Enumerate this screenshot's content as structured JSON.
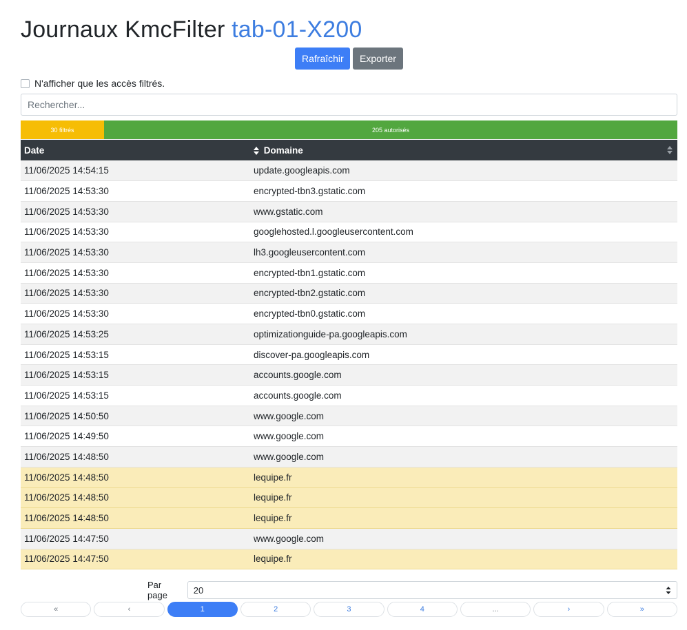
{
  "header": {
    "title": "Journaux KmcFilter",
    "device": "tab-01-X200"
  },
  "toolbar": {
    "refresh_label": "Rafraîchir",
    "export_label": "Exporter"
  },
  "filter": {
    "only_filtered_label": "N'afficher que les accès filtrés.",
    "checked": false
  },
  "search": {
    "placeholder": "Rechercher..."
  },
  "stats": {
    "filtered_label": "30 filtrés",
    "allowed_label": "205 autorisés",
    "filtered_color": "#f6bd05",
    "allowed_color": "#52a73f"
  },
  "table": {
    "headers": [
      "Date",
      "Domaine"
    ],
    "rows": [
      {
        "date": "11/06/2025 14:54:15",
        "domain": "update.googleapis.com",
        "blocked": false
      },
      {
        "date": "11/06/2025 14:53:30",
        "domain": "encrypted-tbn3.gstatic.com",
        "blocked": false
      },
      {
        "date": "11/06/2025 14:53:30",
        "domain": "www.gstatic.com",
        "blocked": false
      },
      {
        "date": "11/06/2025 14:53:30",
        "domain": "googlehosted.l.googleusercontent.com",
        "blocked": false
      },
      {
        "date": "11/06/2025 14:53:30",
        "domain": "lh3.googleusercontent.com",
        "blocked": false
      },
      {
        "date": "11/06/2025 14:53:30",
        "domain": "encrypted-tbn1.gstatic.com",
        "blocked": false
      },
      {
        "date": "11/06/2025 14:53:30",
        "domain": "encrypted-tbn2.gstatic.com",
        "blocked": false
      },
      {
        "date": "11/06/2025 14:53:30",
        "domain": "encrypted-tbn0.gstatic.com",
        "blocked": false
      },
      {
        "date": "11/06/2025 14:53:25",
        "domain": "optimizationguide-pa.googleapis.com",
        "blocked": false
      },
      {
        "date": "11/06/2025 14:53:15",
        "domain": "discover-pa.googleapis.com",
        "blocked": false
      },
      {
        "date": "11/06/2025 14:53:15",
        "domain": "accounts.google.com",
        "blocked": false
      },
      {
        "date": "11/06/2025 14:53:15",
        "domain": "accounts.google.com",
        "blocked": false
      },
      {
        "date": "11/06/2025 14:50:50",
        "domain": "www.google.com",
        "blocked": false
      },
      {
        "date": "11/06/2025 14:49:50",
        "domain": "www.google.com",
        "blocked": false
      },
      {
        "date": "11/06/2025 14:48:50",
        "domain": "www.google.com",
        "blocked": false
      },
      {
        "date": "11/06/2025 14:48:50",
        "domain": "lequipe.fr",
        "blocked": true
      },
      {
        "date": "11/06/2025 14:48:50",
        "domain": "lequipe.fr",
        "blocked": true
      },
      {
        "date": "11/06/2025 14:48:50",
        "domain": "lequipe.fr",
        "blocked": true
      },
      {
        "date": "11/06/2025 14:47:50",
        "domain": "www.google.com",
        "blocked": false
      },
      {
        "date": "11/06/2025 14:47:50",
        "domain": "lequipe.fr",
        "blocked": true
      }
    ]
  },
  "pagination": {
    "per_page_label": "Par page",
    "per_page_value": "20",
    "pages": [
      {
        "label": "«",
        "kind": "muted"
      },
      {
        "label": "‹",
        "kind": "muted"
      },
      {
        "label": "1",
        "kind": "active"
      },
      {
        "label": "2",
        "kind": "link"
      },
      {
        "label": "3",
        "kind": "link"
      },
      {
        "label": "4",
        "kind": "link"
      },
      {
        "label": "...",
        "kind": "muted"
      },
      {
        "label": "›",
        "kind": "link"
      },
      {
        "label": "»",
        "kind": "link"
      }
    ]
  }
}
